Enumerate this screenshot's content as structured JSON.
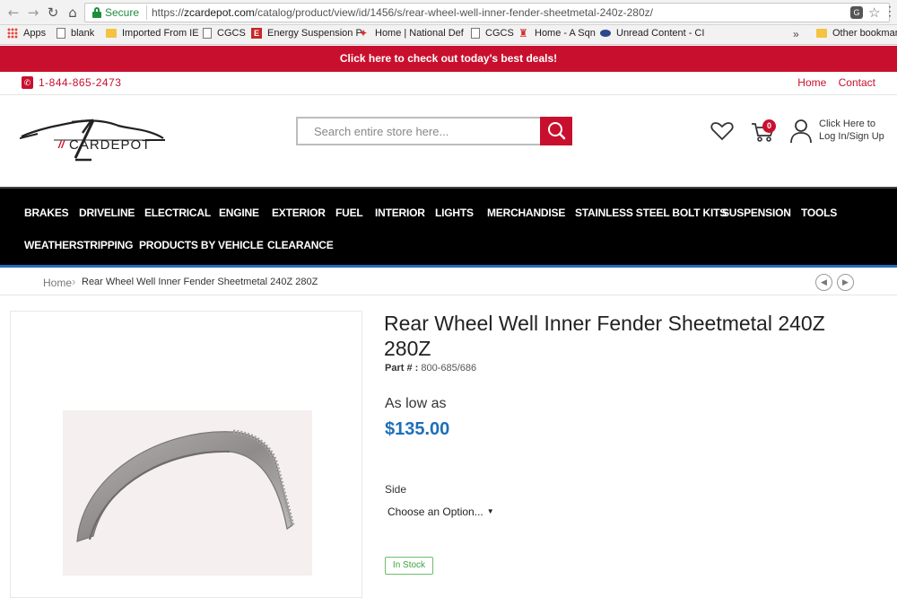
{
  "browser": {
    "secure_label": "Secure",
    "url_scheme": "https://",
    "url_host": "zcardepot.com",
    "url_path": "/catalog/product/view/id/1456/s/rear-wheel-well-inner-fender-sheetmetal-240z-280z/",
    "bookmarks": [
      "Apps",
      "blank",
      "Imported From IE",
      "CGCS",
      "Energy Suspension P",
      "Home | National Def",
      "CGCS",
      "Home - A Sqn",
      "Unread Content - CI"
    ],
    "more_label": "»",
    "other_bookmarks": "Other bookmark"
  },
  "promo": {
    "text": "Click here to check out today's best deals!"
  },
  "topbar": {
    "phone": "1-844-865-2473",
    "links": [
      "Home",
      "Contact"
    ]
  },
  "header": {
    "logo_text": "CARDEPOT",
    "logo_mark": "//",
    "search_placeholder": "Search entire store here...",
    "cart_count": "0",
    "login_line1": "Click Here to",
    "login_line2": "Log In/Sign Up"
  },
  "nav": {
    "row1": [
      "BRAKES",
      "DRIVELINE",
      "ELECTRICAL",
      "ENGINE",
      "EXTERIOR",
      "FUEL",
      "INTERIOR",
      "LIGHTS",
      "MERCHANDISE",
      "STAINLESS STEEL BOLT KITS",
      "SUSPENSION",
      "TOOLS"
    ],
    "row2": [
      "WEATHERSTRIPPING",
      "PRODUCTS BY VEHICLE",
      "CLEARANCE"
    ]
  },
  "breadcrumb": {
    "home": "Home",
    "separator": "›",
    "current": "Rear Wheel Well Inner Fender Sheetmetal 240Z 280Z"
  },
  "product": {
    "title": "Rear Wheel Well Inner Fender Sheetmetal 240Z 280Z",
    "part_label": "Part # :",
    "part_number": "800-685/686",
    "price_prefix": "As low as",
    "price": "$135.00",
    "option_label": "Side",
    "option_value": "Choose an Option...",
    "stock": "In Stock"
  },
  "colors": {
    "brand_red": "#c8102e",
    "price_blue": "#1d6fb8",
    "nav_bg": "#000000",
    "stock_green": "#3fa23f"
  }
}
